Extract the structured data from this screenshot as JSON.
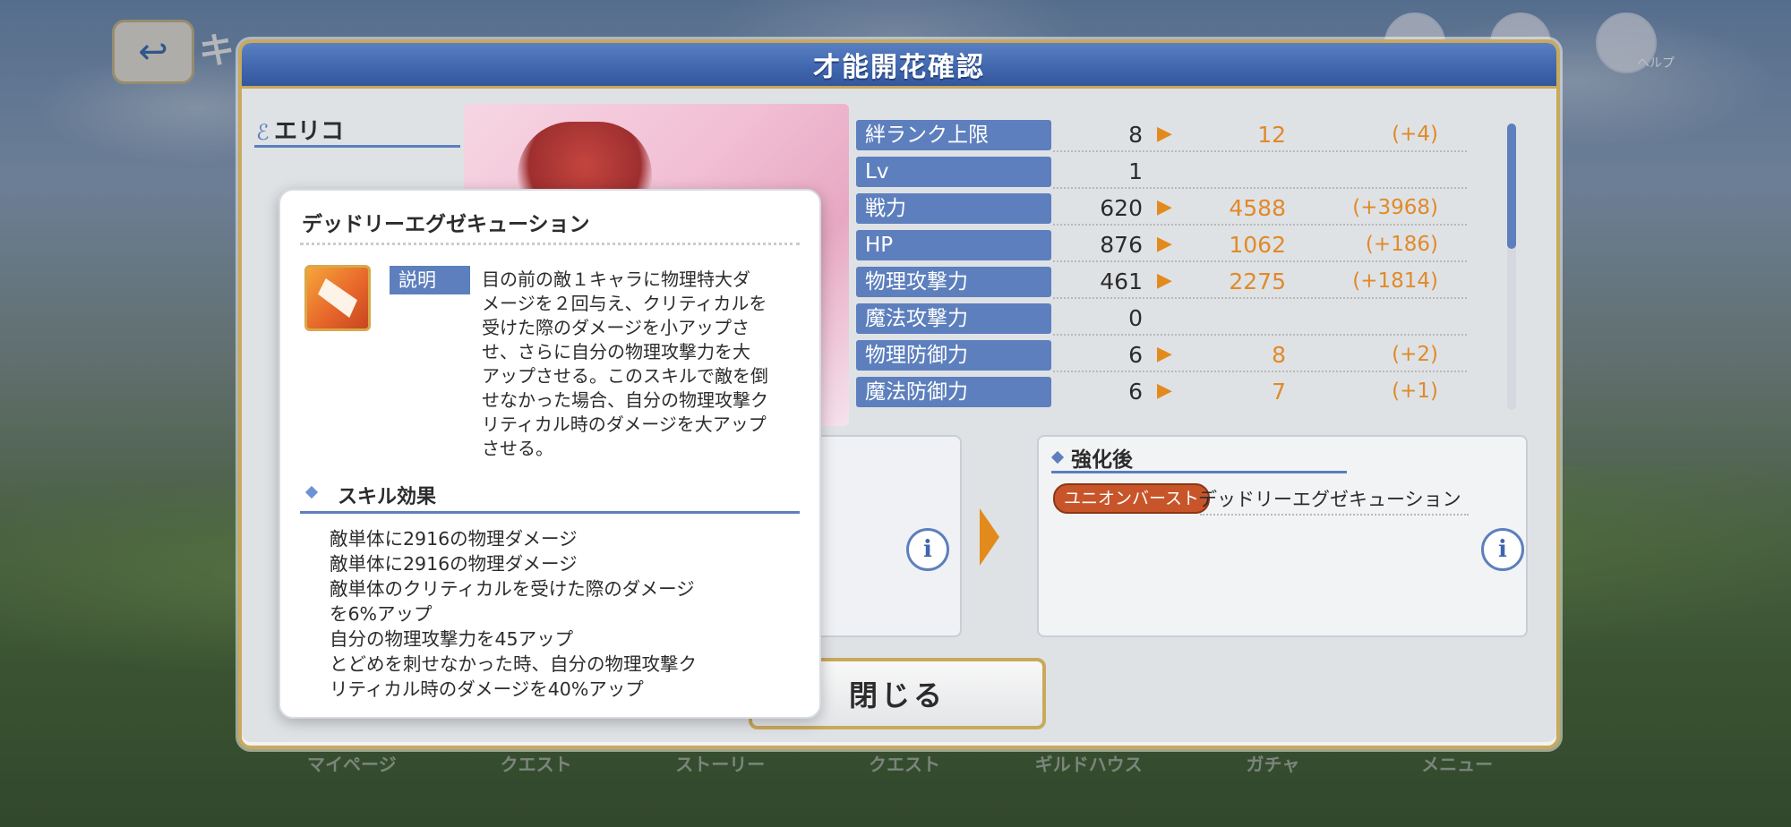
{
  "header": {
    "screen_title": "キ",
    "help_label": "ヘルプ"
  },
  "dialog": {
    "title": "才能開花確認",
    "character_name": "エリコ",
    "close_label": "閉じる"
  },
  "stats": [
    {
      "label": "絆ランク上限",
      "base": "8",
      "new": "12",
      "diff": "(+4)"
    },
    {
      "label": "Lv",
      "base": "1",
      "new": "",
      "diff": ""
    },
    {
      "label": "戦力",
      "base": "620",
      "new": "4588",
      "diff": "(+3968)"
    },
    {
      "label": "HP",
      "base": "876",
      "new": "1062",
      "diff": "(+186)"
    },
    {
      "label": "物理攻撃力",
      "base": "461",
      "new": "2275",
      "diff": "(+1814)"
    },
    {
      "label": "魔法攻撃力",
      "base": "0",
      "new": "",
      "diff": ""
    },
    {
      "label": "物理防御力",
      "base": "6",
      "new": "8",
      "diff": "(+2)"
    },
    {
      "label": "魔法防御力",
      "base": "6",
      "new": "7",
      "diff": "(+1)"
    }
  ],
  "skill_after": {
    "heading": "強化後",
    "tag": "ユニオンバースト",
    "skill_name": "デッドリーエグゼキューション"
  },
  "tooltip": {
    "title": "デッドリーエグゼキューション",
    "desc_badge": "説明",
    "description_lines": [
      "目の前の敵１キャラに物理特大ダ",
      "メージを２回与え、クリティカルを",
      "受けた際のダメージを小アップさ",
      "せ、さらに自分の物理攻撃力を大",
      "アップさせる。このスキルで敵を倒",
      "せなかった場合、自分の物理攻撃ク",
      "リティカル時のダメージを大アップ",
      "させる。"
    ],
    "effect_heading": "スキル効果",
    "effect_lines": [
      "敵単体に2916の物理ダメージ",
      "敵単体に2916の物理ダメージ",
      "敵単体のクリティカルを受けた際のダメージ",
      "を6%アップ",
      "自分の物理攻撃力を45アップ",
      "とどめを刺せなかった時、自分の物理攻撃ク",
      "リティカル時のダメージを40%アップ"
    ]
  },
  "bottom_nav": [
    "マイページ",
    "クエスト",
    "ストーリー",
    "クエスト",
    "ギルドハウス",
    "ガチャ",
    "メニュー"
  ],
  "colors": {
    "accent_blue": "#5d7fbd",
    "gold_border": "#c9a95b",
    "orange_value": "#e08a2a",
    "union_burst_tag": "#c8552a"
  }
}
